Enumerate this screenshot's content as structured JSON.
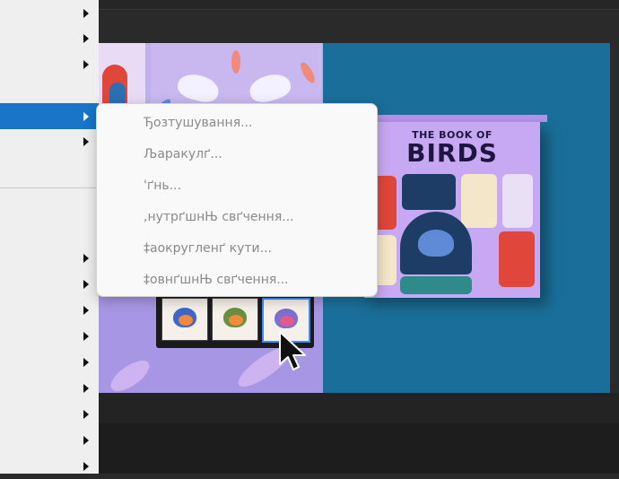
{
  "context_menu": {
    "items": [
      {
        "label": "Ђозтушування..."
      },
      {
        "label": "Љаракулґ..."
      },
      {
        "label": "'ґнь..."
      },
      {
        "label": ",нутрґшнЊ свґчення..."
      },
      {
        "label": "‡аокругленґ кути..."
      },
      {
        "label": "‡овнґшнЊ свґчення..."
      }
    ]
  },
  "book": {
    "title_small": "THE BOOK OF",
    "title_big": "BIRDS"
  },
  "colors": {
    "selection": "#1975c8",
    "canvas_bg_right": "#1a6f9a",
    "canvas_bg_left": "#bfb3ea",
    "book_cover": "#c7a8f2"
  }
}
